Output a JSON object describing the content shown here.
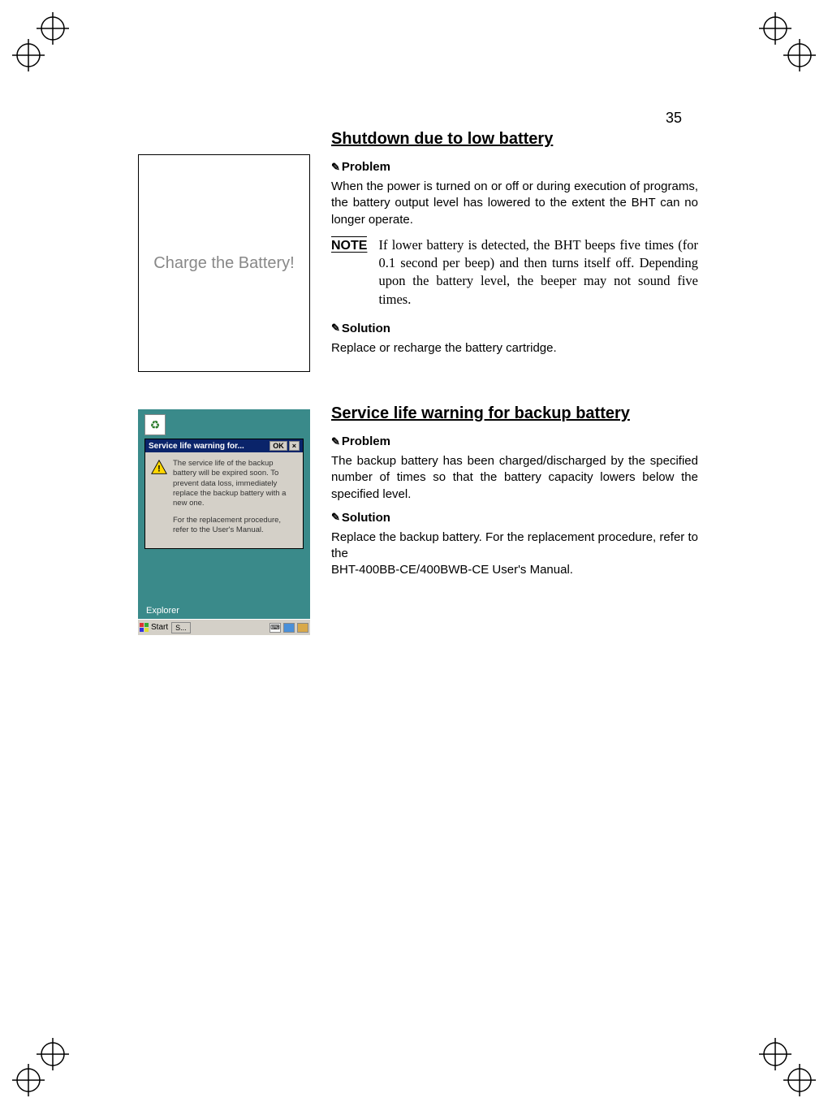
{
  "page_number": "35",
  "section1": {
    "title": "Shutdown due to low battery",
    "screen_text": "Charge the Battery!",
    "problem_label": "Problem",
    "problem_text": "When the power is turned on or off or during execution of programs, the battery output level has lowered to the extent the BHT can no longer operate.",
    "note_label": "NOTE",
    "note_text": "If lower battery is detected, the BHT beeps five times (for 0.1 second per beep) and then turns itself off. Depending upon the battery level, the beeper may not sound five times.",
    "solution_label": "Solution",
    "solution_text": "Replace or recharge the battery cartridge."
  },
  "section2": {
    "title": "Service life warning for backup battery",
    "problem_label": "Problem",
    "problem_text": "The backup battery has been charged/discharged by the specified number of times so that the battery capacity lowers below the specified level.",
    "solution_label": "Solution",
    "solution_text1": "Replace the backup battery. For the replacement procedure, refer to the",
    "solution_text2": "BHT-400BB-CE/400BWB-CE User's Manual.",
    "screenshot": {
      "dialog_title": "Service life warning for...",
      "ok": "OK",
      "close": "×",
      "msg1": "The service life of the backup battery will be expired soon. To prevent data loss, immediately replace the backup battery with a new one.",
      "msg2": "For the replacement procedure, refer to the User's Manual.",
      "explorer": "Explorer",
      "start": "Start",
      "task": "S...",
      "recycle": "♻"
    }
  }
}
